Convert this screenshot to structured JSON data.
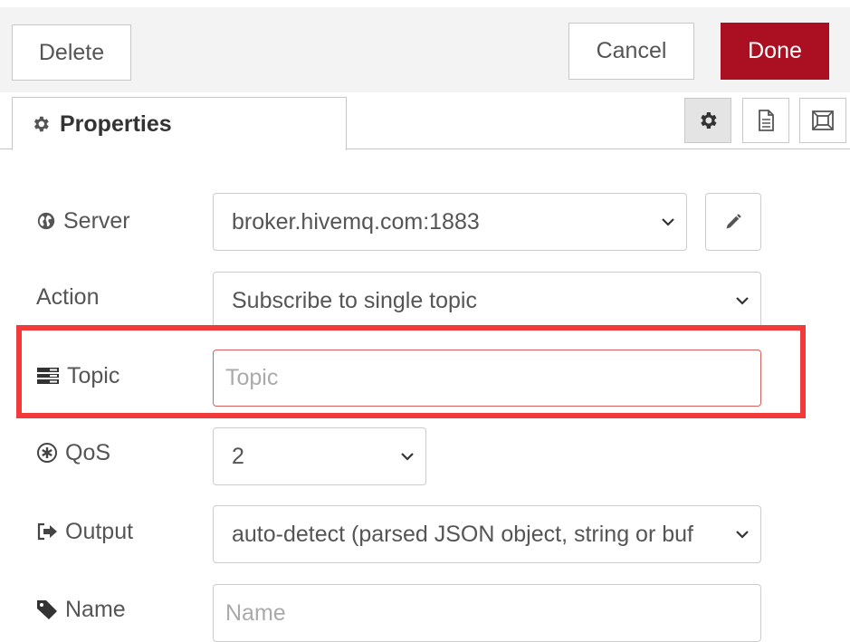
{
  "header": {
    "delete_label": "Delete",
    "cancel_label": "Cancel",
    "done_label": "Done"
  },
  "tabs": {
    "properties_label": "Properties",
    "icons": [
      "gear-icon",
      "document-icon",
      "frame-icon"
    ]
  },
  "form": {
    "server": {
      "label": "Server",
      "value": "broker.hivemq.com:1883",
      "icon": "globe-icon"
    },
    "action": {
      "label": "Action",
      "value": "Subscribe to single topic"
    },
    "topic": {
      "label": "Topic",
      "placeholder": "Topic",
      "value": "",
      "icon": "tasks-icon"
    },
    "qos": {
      "label": "QoS",
      "value": "2",
      "icon": "qos-icon"
    },
    "output": {
      "label": "Output",
      "value": "auto-detect (parsed JSON object, string or buf",
      "icon": "sign-out-icon"
    },
    "name": {
      "label": "Name",
      "placeholder": "Name",
      "value": "",
      "icon": "tag-icon"
    }
  },
  "colors": {
    "done_bg": "#aa1021",
    "highlight": "#f23a3a",
    "topic_border": "#d6615f"
  }
}
